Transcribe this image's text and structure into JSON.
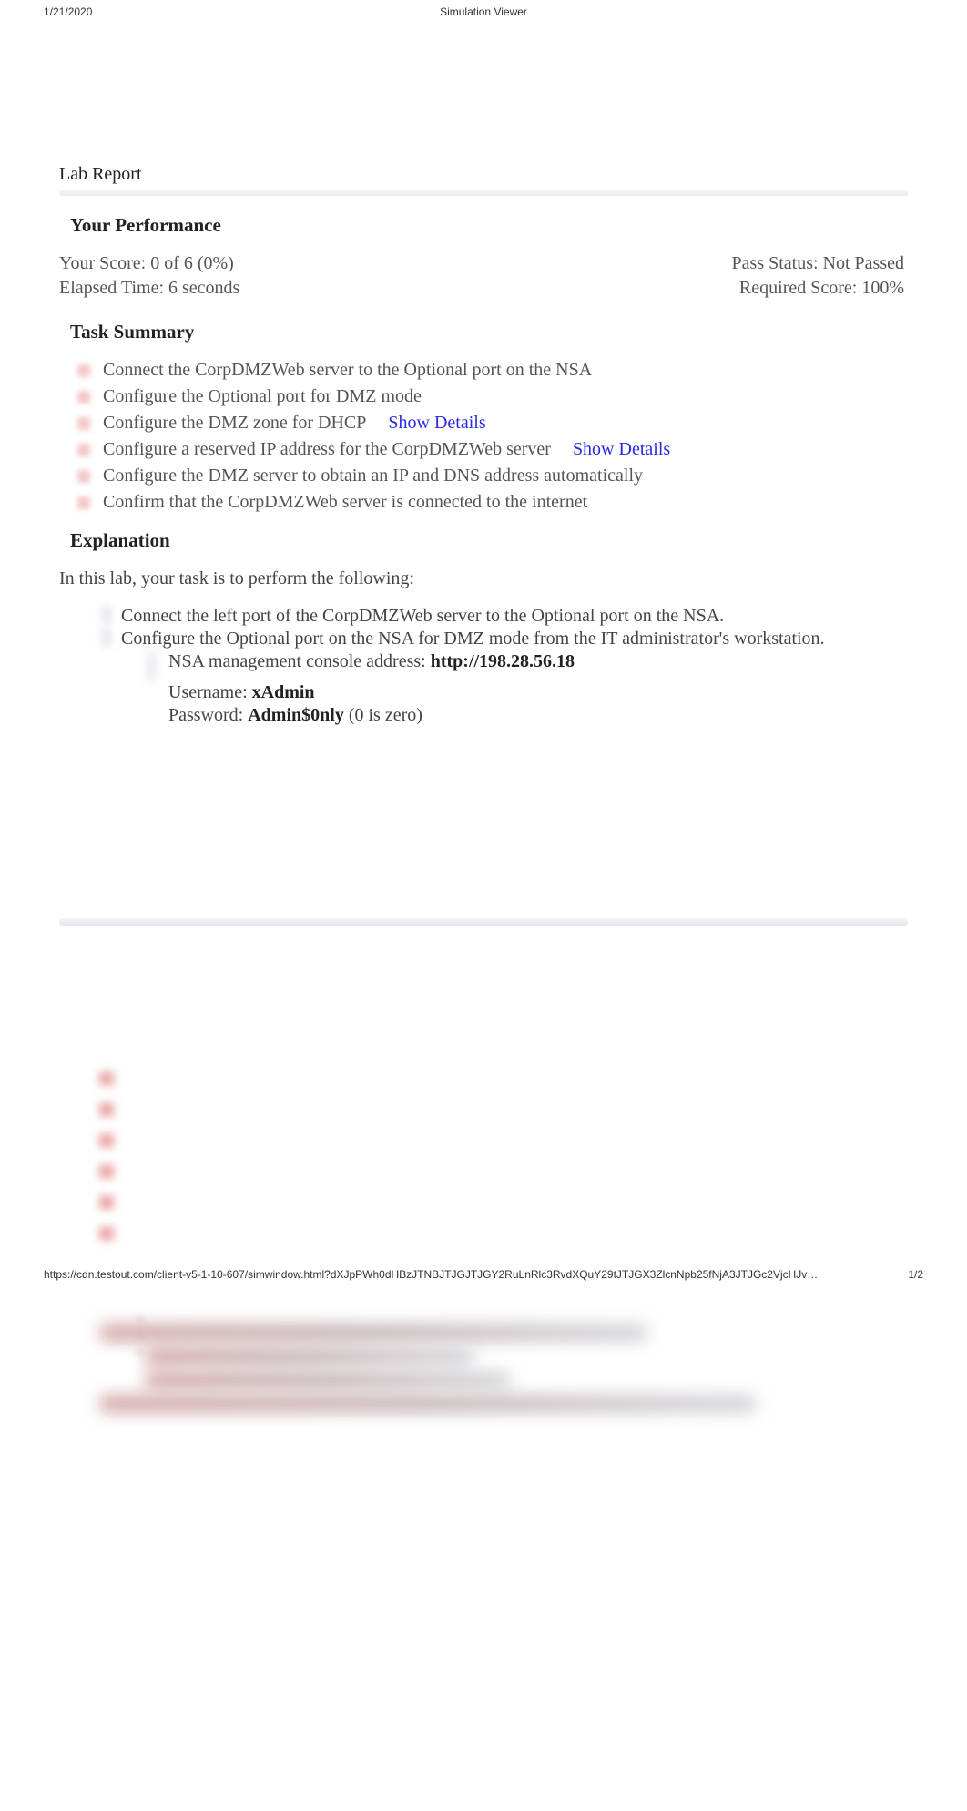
{
  "header": {
    "date": "1/21/2020",
    "title": "Simulation Viewer"
  },
  "report_label": "Lab Report",
  "performance": {
    "heading": "Your Performance",
    "score_label": "Your Score: 0 of 6 (0%)",
    "pass_label": "Pass Status: Not Passed",
    "elapsed_label": "Elapsed Time: 6 seconds",
    "required_label": "Required Score: 100%"
  },
  "tasks": {
    "heading": "Task Summary",
    "show_details_label": "Show Details",
    "items": [
      "Connect the CorpDMZWeb server to the Optional port on the NSA",
      "Configure the Optional port for DMZ mode",
      "Configure the DMZ zone for DHCP",
      "Configure a reserved IP address for the CorpDMZWeb server",
      "Configure the DMZ server to obtain an IP and DNS address automatically",
      "Confirm that the CorpDMZWeb server is connected to the internet"
    ]
  },
  "explanation": {
    "heading": "Explanation",
    "intro": "In this lab, your task is to perform the following:",
    "step1": "Connect the left port of the CorpDMZWeb server to the Optional port on the NSA.",
    "step2": "Configure the Optional port on the NSA for DMZ mode from the IT administrator's workstation.",
    "console_line_prefix": "NSA management console address: ",
    "console_url": "http://198.28.56.18",
    "user_prefix": "Username: ",
    "user_val": "xAdmin",
    "pass_prefix": "Password: ",
    "pass_val": "Admin$0nly",
    "pass_suffix": " (0 is zero)"
  },
  "footer": {
    "url": "https://cdn.testout.com/client-v5-1-10-607/simwindow.html?dXJpPWh0dHBzJTNBJTJGJTJGY2RuLnRlc3RvdXQuY29tJTJGX3ZlcnNpb25fNjA3JTJGc2VjcHJv…",
    "page": "1/2"
  }
}
